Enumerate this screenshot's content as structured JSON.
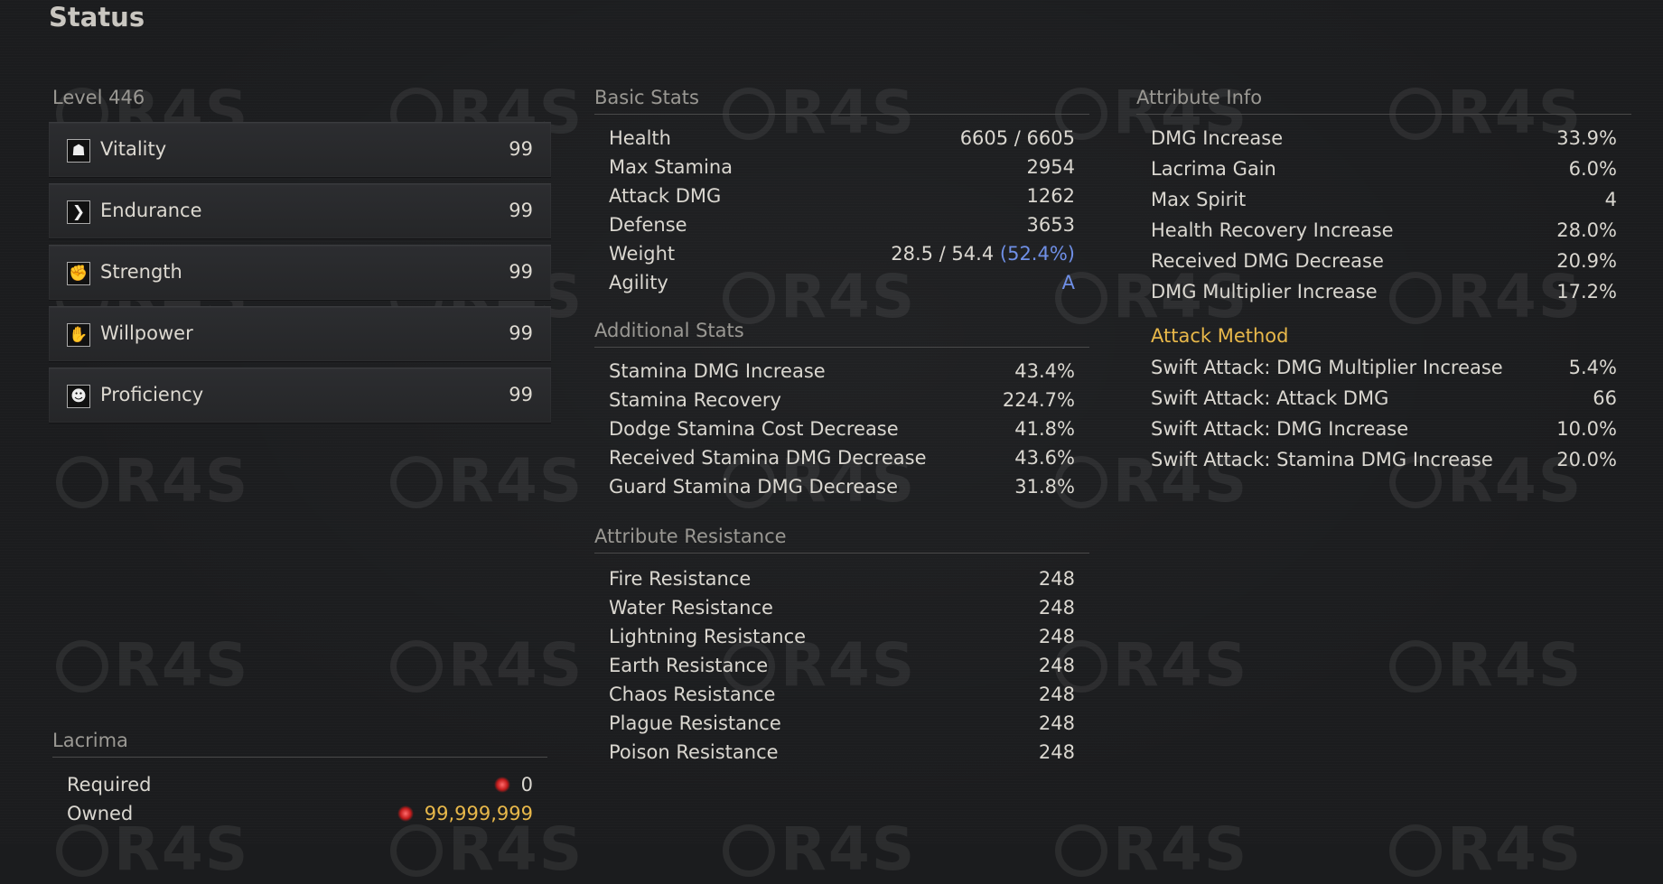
{
  "title": "Status",
  "watermark": "R4S",
  "level": {
    "label": "Level 446"
  },
  "attributes": [
    {
      "label": "Vitality",
      "value": "99",
      "icon": "vitality-icon",
      "glyph": "☗"
    },
    {
      "label": "Endurance",
      "value": "99",
      "icon": "endurance-icon",
      "glyph": "❯"
    },
    {
      "label": "Strength",
      "value": "99",
      "icon": "strength-icon",
      "glyph": "✊"
    },
    {
      "label": "Willpower",
      "value": "99",
      "icon": "willpower-icon",
      "glyph": "✋"
    },
    {
      "label": "Proficiency",
      "value": "99",
      "icon": "proficiency-icon",
      "glyph": "☻"
    }
  ],
  "lacrima": {
    "title": "Lacrima",
    "required_label": "Required",
    "required_value": "0",
    "owned_label": "Owned",
    "owned_value": "99,999,999"
  },
  "basic_stats": {
    "title": "Basic Stats",
    "rows": [
      {
        "label": "Health",
        "value": "6605 / 6605"
      },
      {
        "label": "Max Stamina",
        "value": "2954"
      },
      {
        "label": "Attack DMG",
        "value": "1262"
      },
      {
        "label": "Defense",
        "value": "3653"
      },
      {
        "label": "Weight",
        "value": "28.5 / 54.4",
        "extra": "(52.4%)"
      },
      {
        "label": "Agility",
        "value": "A"
      }
    ]
  },
  "additional_stats": {
    "title": "Additional Stats",
    "rows": [
      {
        "label": "Stamina DMG Increase",
        "value": "43.4%"
      },
      {
        "label": "Stamina Recovery",
        "value": "224.7%"
      },
      {
        "label": "Dodge Stamina Cost Decrease",
        "value": "41.8%"
      },
      {
        "label": "Received Stamina DMG Decrease",
        "value": "43.6%"
      },
      {
        "label": "Guard Stamina DMG Decrease",
        "value": "31.8%"
      }
    ]
  },
  "attribute_resistance": {
    "title": "Attribute Resistance",
    "rows": [
      {
        "label": "Fire Resistance",
        "value": "248"
      },
      {
        "label": "Water Resistance",
        "value": "248"
      },
      {
        "label": "Lightning Resistance",
        "value": "248"
      },
      {
        "label": "Earth Resistance",
        "value": "248"
      },
      {
        "label": "Chaos Resistance",
        "value": "248"
      },
      {
        "label": "Plague Resistance",
        "value": "248"
      },
      {
        "label": "Poison Resistance",
        "value": "248"
      }
    ]
  },
  "attribute_info": {
    "title": "Attribute Info",
    "rows": [
      {
        "label": "DMG Increase",
        "value": "33.9%"
      },
      {
        "label": "Lacrima Gain",
        "value": "6.0%"
      },
      {
        "label": "Max Spirit",
        "value": "4"
      },
      {
        "label": "Health Recovery Increase",
        "value": "28.0%"
      },
      {
        "label": "Received DMG Decrease",
        "value": "20.9%"
      },
      {
        "label": "DMG Multiplier Increase",
        "value": "17.2%"
      }
    ]
  },
  "attack_method": {
    "title": "Attack Method",
    "rows": [
      {
        "label": "Swift Attack: DMG Multiplier Increase",
        "value": "5.4%"
      },
      {
        "label": "Swift Attack: Attack DMG",
        "value": "66"
      },
      {
        "label": "Swift Attack: DMG Increase",
        "value": "10.0%"
      },
      {
        "label": "Swift Attack: Stamina DMG Increase",
        "value": "20.0%"
      }
    ]
  },
  "colors": {
    "accent_blue": "#6f8fe6",
    "accent_gold": "#e8b84a",
    "background": "#1b1c1e"
  }
}
